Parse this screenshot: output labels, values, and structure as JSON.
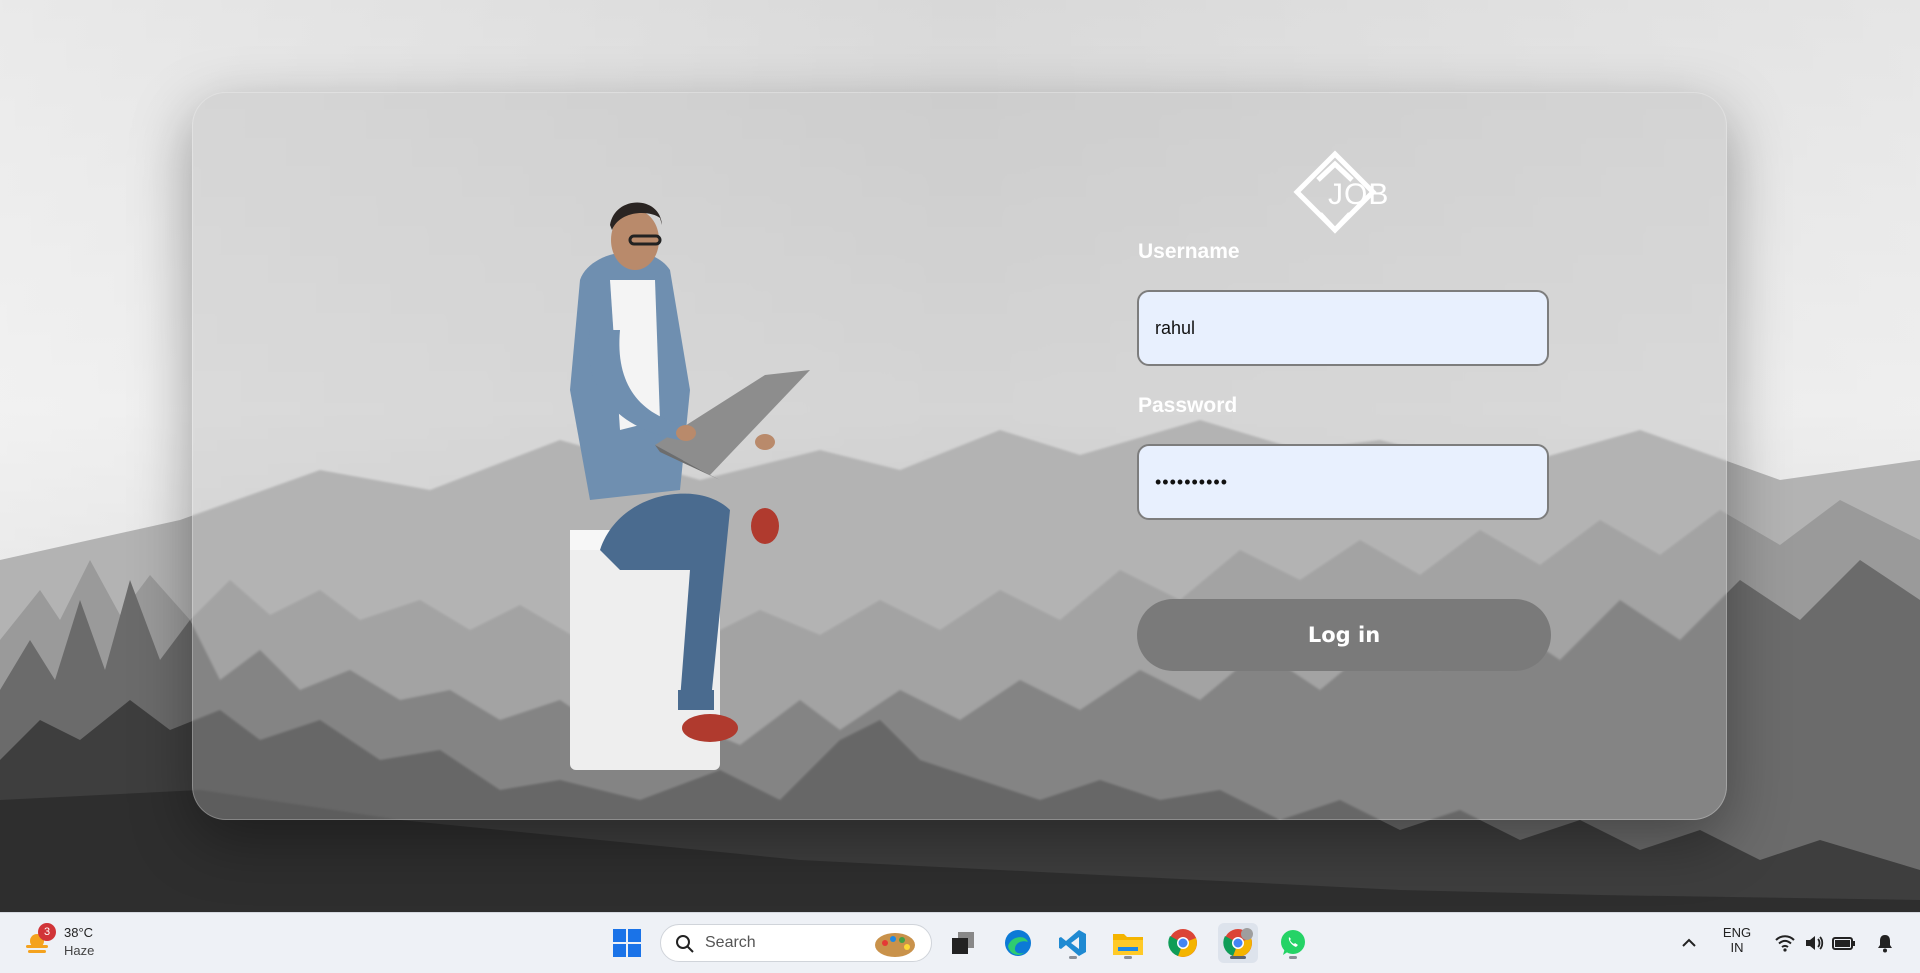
{
  "login": {
    "logo_text": "JOB",
    "username_label": "Username",
    "username_value": "rahul",
    "password_label": "Password",
    "password_value": "••••••••••",
    "login_label": "Log in"
  },
  "taskbar": {
    "weather_badge": "3",
    "weather_temp": "38°C",
    "weather_condition": "Haze",
    "search_label": "Search",
    "language_line1": "ENG",
    "language_line2": "IN",
    "apps": [
      "start-icon",
      "search",
      "task-view-icon",
      "edge-icon",
      "vscode-icon",
      "file-explorer-icon",
      "chrome-icon",
      "chrome-profile-icon",
      "whatsapp-icon"
    ]
  },
  "colors": {
    "button": "#7a7a7a",
    "input_bg": "#e8f0fe",
    "label": "#ffffff"
  }
}
